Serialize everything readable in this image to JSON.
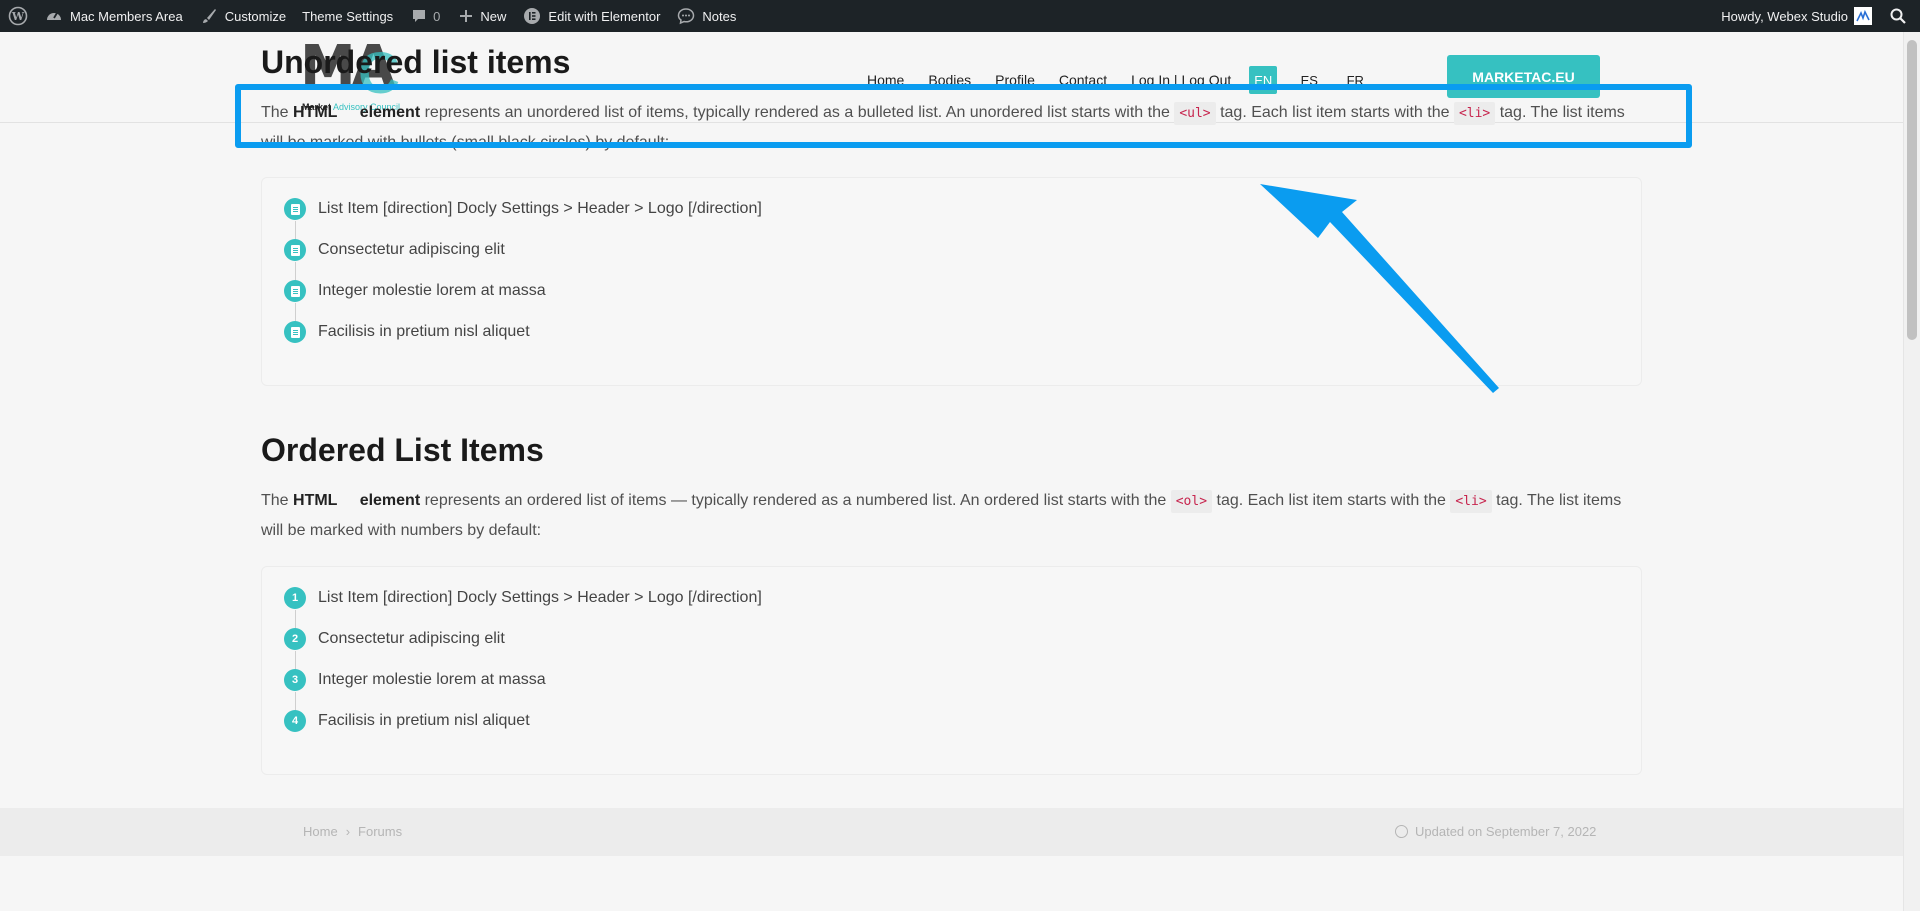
{
  "adminbar": {
    "site_name": "Mac Members Area",
    "customize": "Customize",
    "theme_settings": "Theme Settings",
    "comments_count": "0",
    "new": "New",
    "elementor": "Edit with Elementor",
    "notes": "Notes",
    "howdy": "Howdy, Webex Studio"
  },
  "header": {
    "logo_text": "MAC",
    "logo_sub_bold": "Market",
    "logo_sub_rest": " Advisory Council",
    "nav": [
      "Home",
      "Bodies",
      "Profile",
      "Contact",
      "Log In | Log Out"
    ],
    "languages": [
      "EN",
      "ES",
      "FR"
    ],
    "active_language": "EN",
    "cta_label": "MARKETAC.EU"
  },
  "unordered": {
    "title": "Unordered list items",
    "para_1": "The ",
    "para_html": "HTML",
    "para_element": "element",
    "para_2": " represents an unordered list of items, typically rendered as a bulleted list. An unordered list starts with the ",
    "code_1": "<ul>",
    "para_3": " tag. Each list item starts with the ",
    "code_2": "<li>",
    "para_4": " tag. The list items will be marked with bullets (small black circles) by default:",
    "items": [
      "List Item [direction] Docly Settings > Header > Logo [/direction]",
      "Consectetur adipiscing elit",
      "Integer molestie lorem at massa",
      "Facilisis in pretium nisl aliquet"
    ]
  },
  "ordered": {
    "title": "Ordered List Items",
    "para_1": "The ",
    "para_html": "HTML",
    "para_element": "element",
    "para_2": " represents an ordered list of items — typically rendered as a numbered list. An ordered list starts with the ",
    "code_1": "<ol>",
    "para_3": " tag. Each list item starts with the ",
    "code_2": "<li>",
    "para_4": " tag. The list items will be marked with numbers by default:",
    "numbers": [
      "1",
      "2",
      "3",
      "4"
    ],
    "items": [
      "List Item [direction] Docly Settings > Header > Logo [/direction]",
      "Consectetur adipiscing elit",
      "Integer molestie lorem at massa",
      "Facilisis in pretium nisl aliquet"
    ]
  },
  "footer": {
    "breadcrumb": [
      "Home",
      "Forums"
    ],
    "updated": "Updated on September 7, 2022"
  },
  "colors": {
    "accent": "#36c1c1",
    "annotation": "#0a9cf0",
    "adminbar": "#1d2327"
  }
}
